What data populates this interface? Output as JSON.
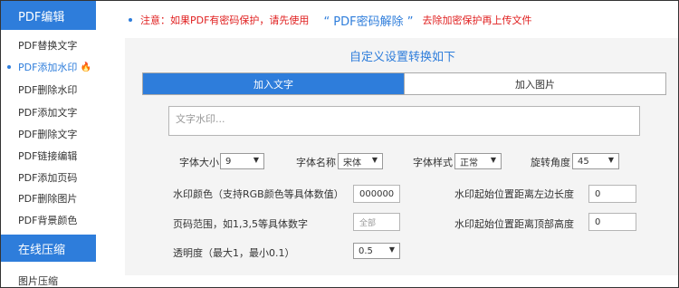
{
  "sidebar": {
    "sections": [
      {
        "title": "PDF编辑",
        "items": [
          {
            "label": "PDF替换文字",
            "active": false
          },
          {
            "label": "PDF添加水印",
            "active": true,
            "badge_icon": "fire-icon"
          },
          {
            "label": "PDF删除水印",
            "active": false
          },
          {
            "label": "PDF添加文字",
            "active": false
          },
          {
            "label": "PDF删除文字",
            "active": false
          },
          {
            "label": "PDF链接编辑",
            "active": false
          },
          {
            "label": "PDF添加页码",
            "active": false
          },
          {
            "label": "PDF删除图片",
            "active": false
          },
          {
            "label": "PDF背景颜色",
            "active": false
          }
        ]
      },
      {
        "title": "在线压缩",
        "items": [
          {
            "label": "图片压缩",
            "active": false
          }
        ]
      }
    ]
  },
  "notice": {
    "text": "注意：如果PDF有密码保护，请先使用",
    "link": "“ PDF密码解除 ”",
    "suffix": "去除加密保护再上传文件"
  },
  "panel": {
    "title": "自定义设置转换如下",
    "tabs": [
      {
        "label": "加入文字",
        "active": true
      },
      {
        "label": "加入图片",
        "active": false
      }
    ],
    "watermark_text": {
      "value": "",
      "placeholder": "文字水印..."
    },
    "font_size": {
      "label": "字体大小",
      "value": "9"
    },
    "font_name": {
      "label": "字体名称",
      "value": "宋体"
    },
    "font_style": {
      "label": "字体样式",
      "value": "正常"
    },
    "rotation": {
      "label": "旋转角度",
      "value": "45"
    },
    "color": {
      "label": "水印颜色（支持RGB颜色等具体数值）",
      "value": "000000"
    },
    "offset_left": {
      "label": "水印起始位置距离左边长度",
      "value": "0"
    },
    "page_range": {
      "label": "页码范围，如1,3,5等具体数字",
      "value": "",
      "placeholder": "全部"
    },
    "offset_top": {
      "label": "水印起始位置距离顶部高度",
      "value": "0"
    },
    "opacity": {
      "label": "透明度（最大1，最小0.1）",
      "value": "0.5"
    }
  },
  "colors": {
    "accent": "#2e7ddb",
    "warning": "#e02020",
    "panel_bg": "#f4f4f4"
  }
}
